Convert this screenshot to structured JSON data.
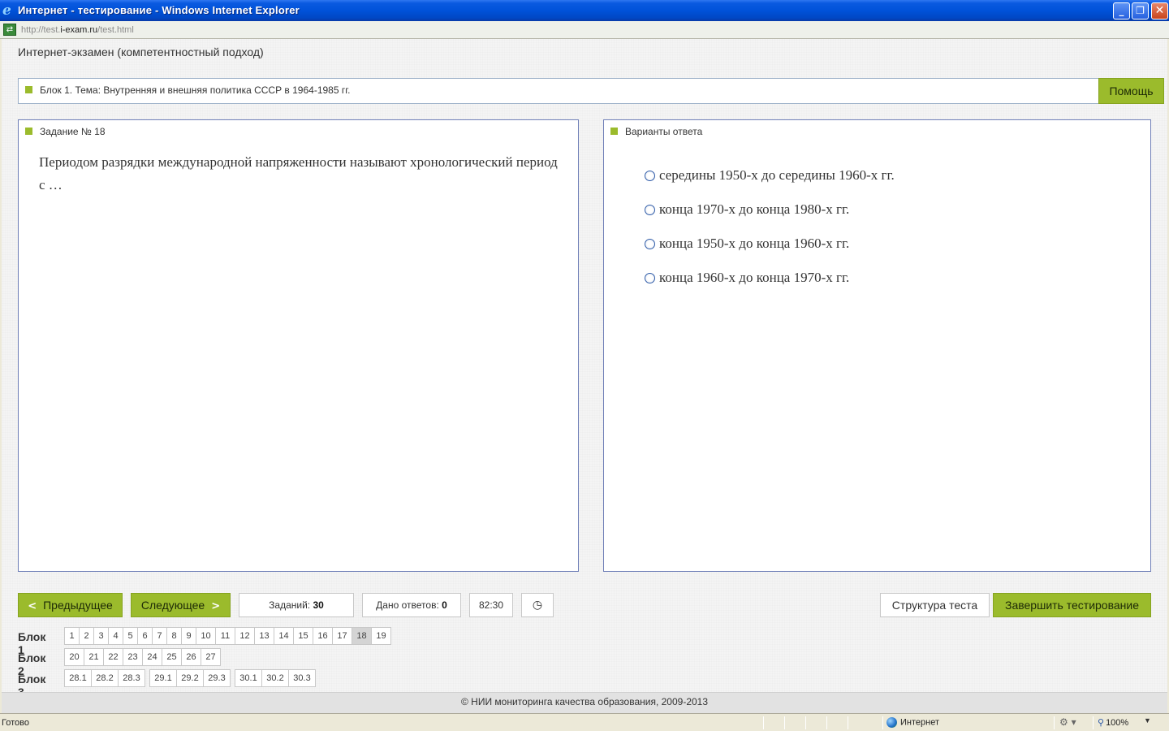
{
  "window": {
    "title": "Интернет - тестирование - Windows Internet Explorer",
    "url_prefix": "http://test.",
    "url_host": "i-exam.ru",
    "url_path": "/test.html"
  },
  "exam": {
    "title": "Интернет-экзамен (компетентностный подход)",
    "block_label": "Блок 1. Тема: Внутренняя и внешняя политика СССР в 1964-1985 гг.",
    "help_label": "Помощь"
  },
  "task": {
    "header": "Задание № 18",
    "text": "Периодом разрядки международной напряженности называют хронологический период с …"
  },
  "answers": {
    "header": "Варианты ответа",
    "options": [
      "середины 1950-х до середины 1960-х гг.",
      "конца 1970-х до конца 1980-х гг.",
      "конца 1950-х до конца 1960-х гг.",
      "конца 1960-х до конца 1970-х гг."
    ]
  },
  "controls": {
    "prev_label": "Предыдущее",
    "next_label": "Следующее",
    "tasks_label": "Заданий:",
    "tasks_value": "30",
    "given_label": "Дано ответов:",
    "given_value": "0",
    "timer": "82:30",
    "clock_icon": "clock-icon",
    "structure_label": "Структура теста",
    "finish_label": "Завершить тестирование"
  },
  "navigation": {
    "current": "18",
    "blocks": [
      {
        "label": "Блок 1",
        "items": [
          "1",
          "2",
          "3",
          "4",
          "5",
          "6",
          "7",
          "8",
          "9",
          "10",
          "11",
          "12",
          "13",
          "14",
          "15",
          "16",
          "17",
          "18",
          "19"
        ]
      },
      {
        "label": "Блок 2",
        "items": [
          "20",
          "21",
          "22",
          "23",
          "24",
          "25",
          "26",
          "27"
        ]
      },
      {
        "label": "Блок 3",
        "items": [
          "28.1",
          "28.2",
          "28.3",
          "29.1",
          "29.2",
          "29.3",
          "30.1",
          "30.2",
          "30.3"
        ]
      }
    ]
  },
  "footer": "© НИИ мониторинга качества образования, 2009-2013",
  "status": {
    "ready": "Готово",
    "zone": "Интернет",
    "zoom": "100%"
  },
  "colors": {
    "accent_green": "#9bbb2c",
    "panel_border": "#6f7fb7",
    "titlebar_blue": "#0052d9"
  }
}
